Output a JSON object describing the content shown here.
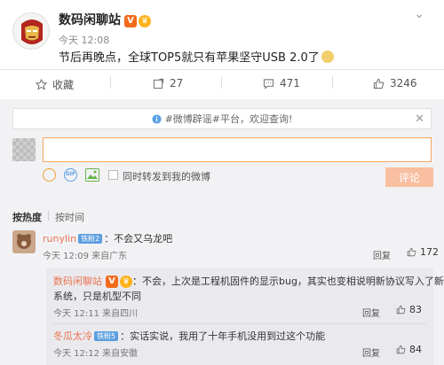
{
  "post": {
    "author": "数码闲聊站",
    "time": "今天 12:08",
    "text": "节后再晚点，全球TOP5就只有苹果坚守USB 2.0了"
  },
  "actions": {
    "collect": "收藏",
    "repost": "27",
    "comment": "471",
    "like": "3246"
  },
  "notice": "#微博辟谣#平台，欢迎查询!",
  "composer": {
    "input_value": "",
    "repost_label": "同时转发到我的微博",
    "submit": "评论"
  },
  "sort": {
    "hot": "按热度",
    "time": "按时间"
  },
  "comments": [
    {
      "user": "runylin",
      "level": "铁粉2",
      "text": "：不会又乌龙吧",
      "meta": "今天 12:09 来自广东",
      "reply": "回复",
      "likes": "172"
    },
    {
      "user": "数码闲聊站",
      "text_line1": "：不会，上次是工程机固件的显示bug，其实也变相说明新协议写入了新",
      "text_line2": "系统，只是机型不同",
      "meta": "今天 12:11 来自四川",
      "reply": "回复",
      "likes": "83"
    },
    {
      "user": "冬瓜太冷",
      "level": "铁粉5",
      "text": "：实话实说，我用了十年手机没用到过这个功能",
      "meta": "今天 12:12 来自安徽",
      "reply": "回复",
      "likes": "84"
    }
  ],
  "colors": {
    "accent": "#eb7350",
    "input_border": "#f7a55e",
    "submit_bg": "#f8bfa0",
    "panel_bg": "#f2f2f5"
  }
}
